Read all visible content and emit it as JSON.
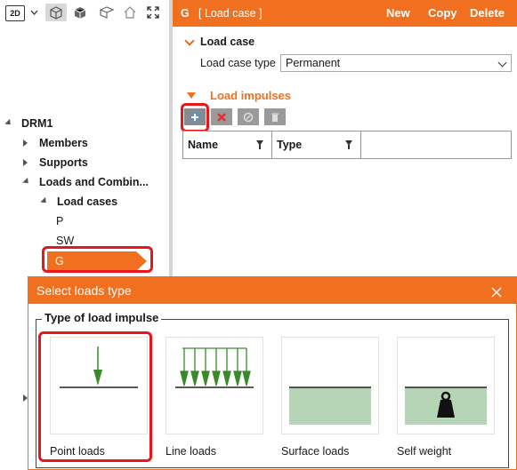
{
  "toolbar": {
    "view_mode": "2D",
    "icons": [
      "view-mode-dropdown-icon",
      "wireframe-icon",
      "solid-icon",
      "section-icon",
      "home-icon",
      "fullscreen-icon"
    ]
  },
  "tree": {
    "root": "DRM1",
    "members": "Members",
    "supports": "Supports",
    "loads": "Loads and Combin...",
    "load_cases": "Load cases",
    "items": [
      "P",
      "SW",
      "G"
    ]
  },
  "header": {
    "case_name": "G",
    "case_kind": "[ Load case ]",
    "new_label": "New",
    "copy_label": "Copy",
    "delete_label": "Delete"
  },
  "load_case": {
    "section_title": "Load case",
    "type_label": "Load case type",
    "type_value": "Permanent"
  },
  "load_impulses": {
    "section_title": "Load impulses",
    "columns": [
      "Name",
      "Type"
    ]
  },
  "dialog": {
    "title": "Select loads type",
    "group_title": "Type of load impulse",
    "options": [
      "Point loads",
      "Line loads",
      "Surface loads",
      "Self weight"
    ]
  },
  "colors": {
    "accent": "#f07020",
    "highlight": "#e8151b",
    "arrow_green": "#3a8a2a",
    "surface_green": "#b6d4b6"
  }
}
